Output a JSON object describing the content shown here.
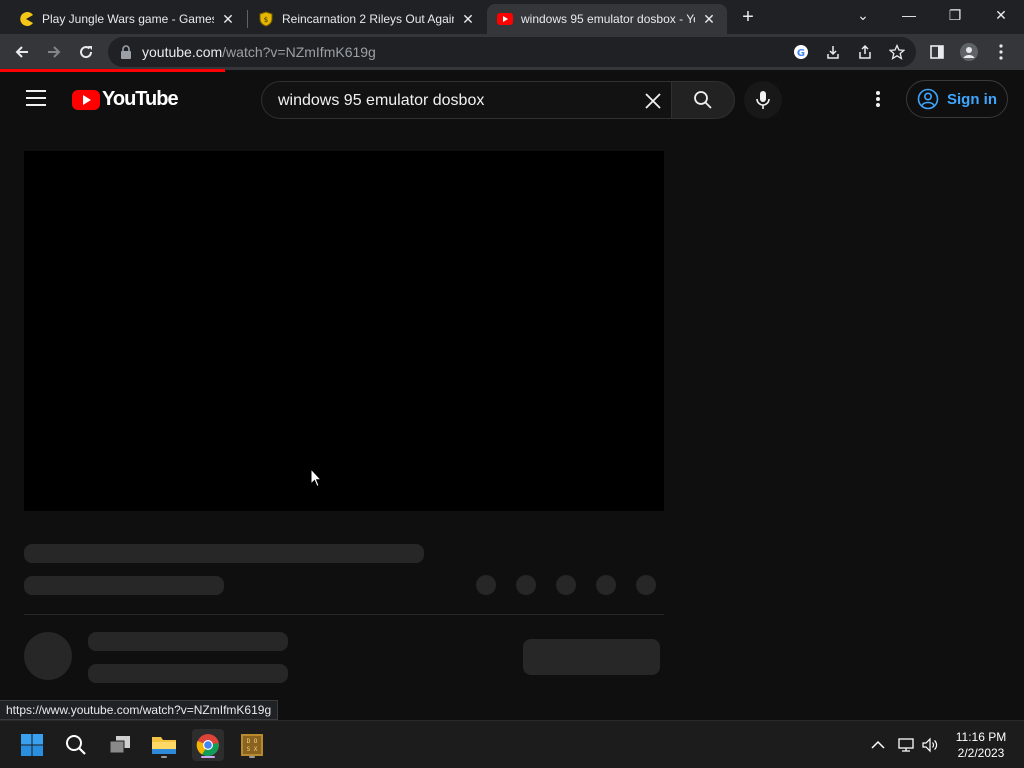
{
  "browser": {
    "tabs": [
      {
        "title": "Play Jungle Wars game - Gamesfi",
        "close": "✕",
        "favicon": "pacman-icon",
        "active": false
      },
      {
        "title": "Reincarnation 2 Rileys Out Again",
        "close": "✕",
        "favicon": "shield-icon",
        "active": false
      },
      {
        "title": "windows 95 emulator dosbox - Yo",
        "close": "✕",
        "favicon": "youtube-icon",
        "active": true
      }
    ],
    "new_tab": "+",
    "window_controls": {
      "dropdown": "⌄",
      "minimize": "—",
      "restore": "❐",
      "close": "✕"
    },
    "url_host": "youtube.com",
    "url_path": "/watch?v=NZmIfmK619g",
    "status_url": "https://www.youtube.com/watch?v=NZmIfmK619g",
    "loading_progress": 0.22
  },
  "youtube": {
    "logo_text": "YouTube",
    "search_query": "windows 95 emulator dosbox",
    "sign_in": "Sign in",
    "brand_color": "#ff0000",
    "link_color": "#3ea6ff"
  },
  "taskbar": {
    "time": "11:16 PM",
    "date": "2/2/2023",
    "pinned": [
      "windows-start-icon",
      "search-icon",
      "task-view-icon",
      "file-explorer-icon",
      "chrome-icon",
      "dosbox-icon"
    ]
  }
}
